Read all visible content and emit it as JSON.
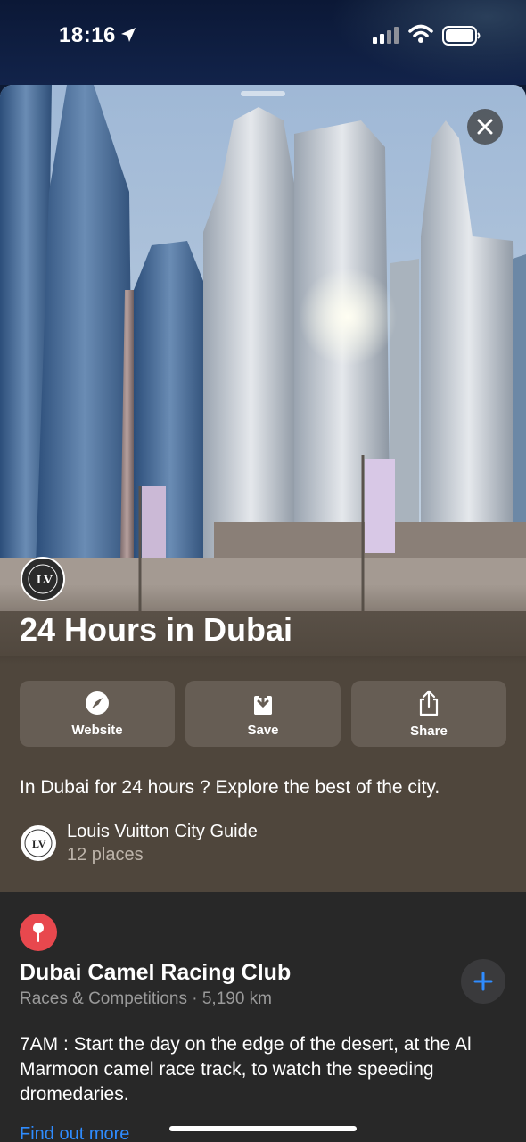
{
  "status_bar": {
    "time": "18:16"
  },
  "sheet": {
    "title": "24 Hours in Dubai",
    "actions": [
      {
        "label": "Website",
        "icon": "compass-icon"
      },
      {
        "label": "Save",
        "icon": "download-icon"
      },
      {
        "label": "Share",
        "icon": "share-icon"
      }
    ],
    "description": "In Dubai for 24 hours ? Explore the best of the city.",
    "author": {
      "name": "Louis Vuitton City Guide",
      "count": "12 places"
    },
    "badge_text": "LOUIS VUITTON CITY GUIDE"
  },
  "place": {
    "name": "Dubai Camel Racing Club",
    "meta": "Races & Competitions · 5,190 km",
    "description": "7AM : Start the day on the edge of the desert, at the Al Marmoon camel race track, to watch the speeding dromedaries.",
    "link": "Find out more"
  },
  "colors": {
    "accent": "#2f8cff",
    "pin": "#e8484e",
    "panel": "#4f463c"
  }
}
